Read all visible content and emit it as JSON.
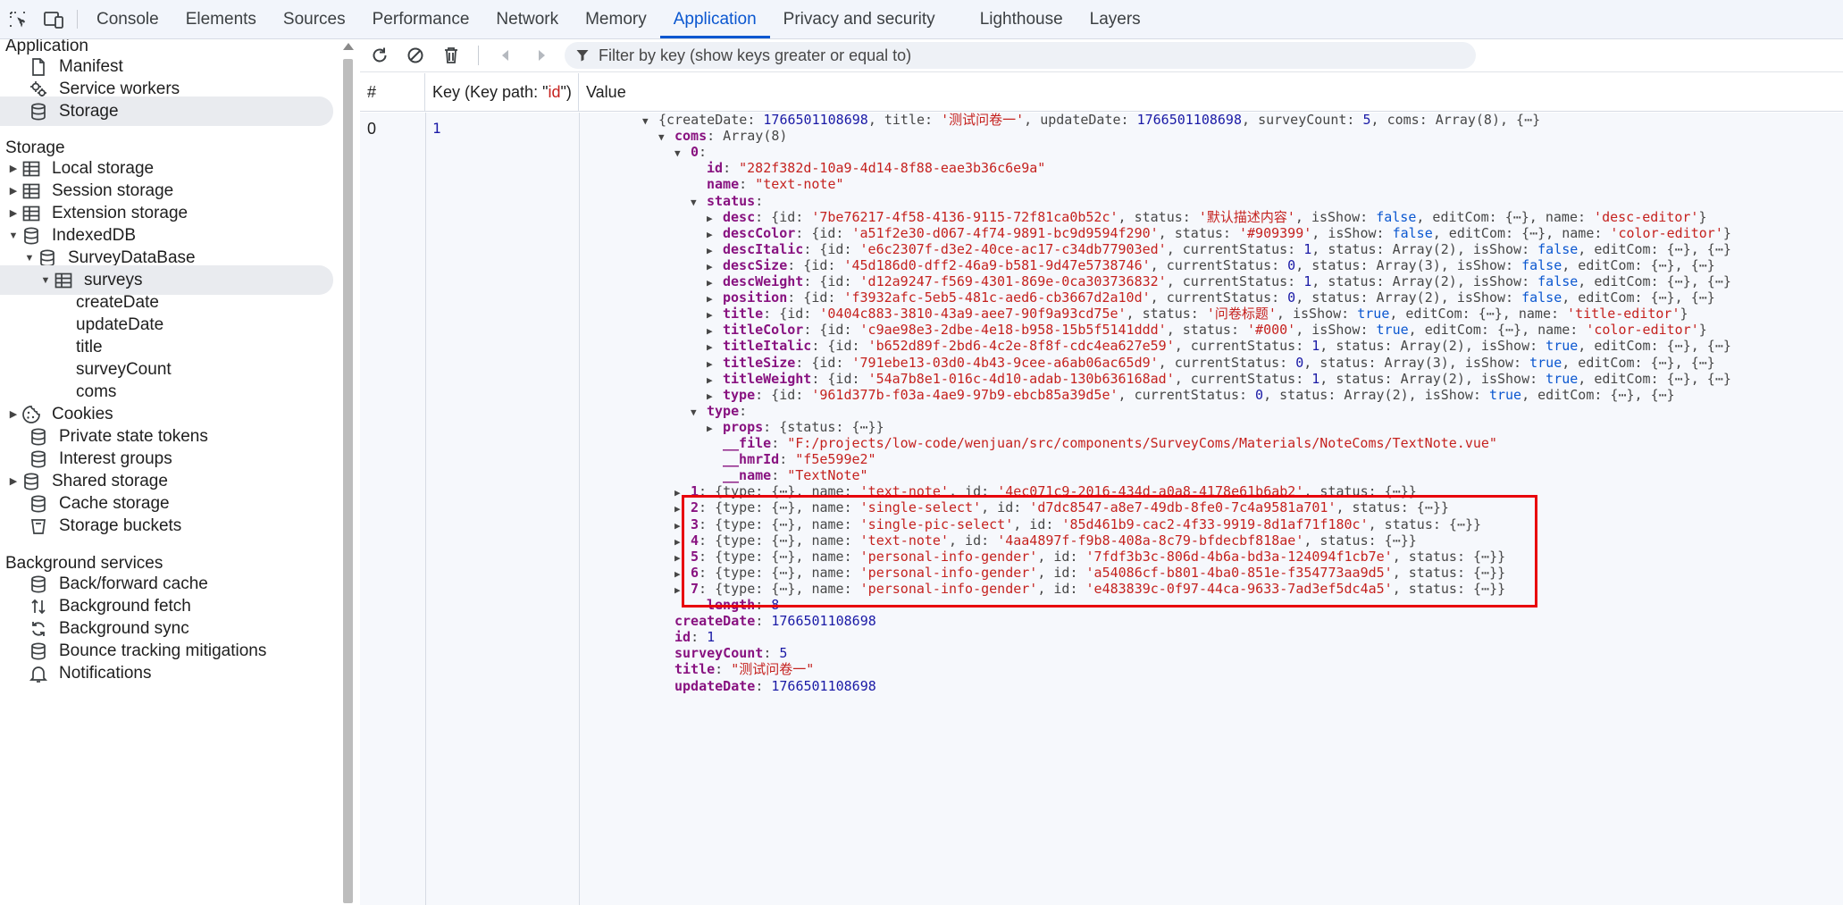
{
  "tabs": [
    "Console",
    "Elements",
    "Sources",
    "Performance",
    "Network",
    "Memory",
    "Application",
    "Privacy and security",
    "Lighthouse",
    "Layers"
  ],
  "active_tab": "Application",
  "sidebar": {
    "sections": [
      {
        "title": "Application"
      },
      {
        "title": "Storage"
      },
      {
        "title": "Background services"
      }
    ],
    "application_items": [
      "Manifest",
      "Service workers",
      "Storage"
    ],
    "storage_items": [
      "Local storage",
      "Session storage",
      "Extension storage",
      "IndexedDB",
      "SurveyDataBase",
      "surveys",
      "createDate",
      "updateDate",
      "title",
      "surveyCount",
      "coms",
      "Cookies",
      "Private state tokens",
      "Interest groups",
      "Shared storage",
      "Cache storage",
      "Storage buckets"
    ],
    "background_items": [
      "Back/forward cache",
      "Background fetch",
      "Background sync",
      "Bounce tracking mitigations",
      "Notifications"
    ]
  },
  "toolbar": {
    "filter_placeholder": "Filter by key (show keys greater or equal to)"
  },
  "table": {
    "col_index": "#",
    "col_key_prefix": "Key (Key path: \"",
    "col_key_path": "id",
    "col_key_suffix": "\")",
    "col_value": "Value",
    "row_index": "0",
    "row_key": "1"
  },
  "tree_lines": [
    [
      [
        null,
        "▼ "
      ],
      [
        "p",
        "{"
      ],
      [
        "kp",
        "createDate"
      ],
      [
        "p",
        ": "
      ],
      [
        "n",
        "1766501108698"
      ],
      [
        "p",
        ", "
      ],
      [
        "kp",
        "title"
      ],
      [
        "p",
        ": "
      ],
      [
        "s",
        "'测试问卷一'"
      ],
      [
        "p",
        ", "
      ],
      [
        "kp",
        "updateDate"
      ],
      [
        "p",
        ": "
      ],
      [
        "n",
        "1766501108698"
      ],
      [
        "p",
        ", "
      ],
      [
        "kp",
        "surveyCount"
      ],
      [
        "p",
        ": "
      ],
      [
        "n",
        "5"
      ],
      [
        "p",
        ", "
      ],
      [
        "kp",
        "coms"
      ],
      [
        "p",
        ": Array(8),  {⋯}"
      ]
    ],
    [
      [
        null,
        "▼ "
      ],
      [
        "k",
        "coms"
      ],
      [
        "p",
        ": Array(8)"
      ]
    ],
    [
      [
        null,
        "▼ "
      ],
      [
        "k",
        "0"
      ],
      [
        "p",
        ":"
      ]
    ],
    [
      [
        null,
        ""
      ],
      [
        "k",
        "id"
      ],
      [
        "p",
        ": "
      ],
      [
        "s",
        "\"282f382d-10a9-4d14-8f88-eae3b36c6e9a\""
      ]
    ],
    [
      [
        null,
        ""
      ],
      [
        "k",
        "name"
      ],
      [
        "p",
        ": "
      ],
      [
        "s",
        "\"text-note\""
      ]
    ],
    [
      [
        null,
        "▼ "
      ],
      [
        "k",
        "status"
      ],
      [
        "p",
        ":"
      ]
    ],
    [
      [
        null,
        "▶ "
      ],
      [
        "k",
        "desc"
      ],
      [
        "p",
        ": {id: "
      ],
      [
        "s",
        "'7be76217-4f58-4136-9115-72f81ca0b52c'"
      ],
      [
        "p",
        ", status: "
      ],
      [
        "s",
        "'默认描述内容'"
      ],
      [
        "p",
        ", isShow: "
      ],
      [
        "b",
        "false"
      ],
      [
        "p",
        ", editCom: {⋯}, name: "
      ],
      [
        "s",
        "'desc-editor'"
      ],
      [
        "p",
        "}"
      ]
    ],
    [
      [
        null,
        "▶ "
      ],
      [
        "k",
        "descColor"
      ],
      [
        "p",
        ": {id: "
      ],
      [
        "s",
        "'a51f2e30-d067-4f74-9891-bc9d9594f290'"
      ],
      [
        "p",
        ", status: "
      ],
      [
        "s",
        "'#909399'"
      ],
      [
        "p",
        ", isShow: "
      ],
      [
        "b",
        "false"
      ],
      [
        "p",
        ", editCom: {⋯}, name: "
      ],
      [
        "s",
        "'color-editor'"
      ],
      [
        "p",
        "}"
      ]
    ],
    [
      [
        null,
        "▶ "
      ],
      [
        "k",
        "descItalic"
      ],
      [
        "p",
        ": {id: "
      ],
      [
        "s",
        "'e6c2307f-d3e2-40ce-ac17-c34db77903ed'"
      ],
      [
        "p",
        ", currentStatus: "
      ],
      [
        "n",
        "1"
      ],
      [
        "p",
        ", status: Array(2), isShow: "
      ],
      [
        "b",
        "false"
      ],
      [
        "p",
        ", editCom: {⋯},  {⋯}"
      ]
    ],
    [
      [
        null,
        "▶ "
      ],
      [
        "k",
        "descSize"
      ],
      [
        "p",
        ": {id: "
      ],
      [
        "s",
        "'45d186d0-dff2-46a9-b581-9d47e5738746'"
      ],
      [
        "p",
        ", currentStatus: "
      ],
      [
        "n",
        "0"
      ],
      [
        "p",
        ", status: Array(3), isShow: "
      ],
      [
        "b",
        "false"
      ],
      [
        "p",
        ", editCom: {⋯},  {⋯}"
      ]
    ],
    [
      [
        null,
        "▶ "
      ],
      [
        "k",
        "descWeight"
      ],
      [
        "p",
        ": {id: "
      ],
      [
        "s",
        "'d12a9247-f569-4301-869e-0ca303736832'"
      ],
      [
        "p",
        ", currentStatus: "
      ],
      [
        "n",
        "1"
      ],
      [
        "p",
        ", status: Array(2), isShow: "
      ],
      [
        "b",
        "false"
      ],
      [
        "p",
        ", editCom: {⋯},  {⋯}"
      ]
    ],
    [
      [
        null,
        "▶ "
      ],
      [
        "k",
        "position"
      ],
      [
        "p",
        ": {id: "
      ],
      [
        "s",
        "'f3932afc-5eb5-481c-aed6-cb3667d2a10d'"
      ],
      [
        "p",
        ", currentStatus: "
      ],
      [
        "n",
        "0"
      ],
      [
        "p",
        ", status: Array(2), isShow: "
      ],
      [
        "b",
        "false"
      ],
      [
        "p",
        ", editCom: {⋯},  {⋯}"
      ]
    ],
    [
      [
        null,
        "▶ "
      ],
      [
        "k",
        "title"
      ],
      [
        "p",
        ": {id: "
      ],
      [
        "s",
        "'0404c883-3810-43a9-aee7-90f9a93cd75e'"
      ],
      [
        "p",
        ", status: "
      ],
      [
        "s",
        "'问卷标题'"
      ],
      [
        "p",
        ", isShow: "
      ],
      [
        "b",
        "true"
      ],
      [
        "p",
        ", editCom: {⋯}, name: "
      ],
      [
        "s",
        "'title-editor'"
      ],
      [
        "p",
        "}"
      ]
    ],
    [
      [
        null,
        "▶ "
      ],
      [
        "k",
        "titleColor"
      ],
      [
        "p",
        ": {id: "
      ],
      [
        "s",
        "'c9ae98e3-2dbe-4e18-b958-15b5f5141ddd'"
      ],
      [
        "p",
        ", status: "
      ],
      [
        "s",
        "'#000'"
      ],
      [
        "p",
        ", isShow: "
      ],
      [
        "b",
        "true"
      ],
      [
        "p",
        ", editCom: {⋯}, name: "
      ],
      [
        "s",
        "'color-editor'"
      ],
      [
        "p",
        "}"
      ]
    ],
    [
      [
        null,
        "▶ "
      ],
      [
        "k",
        "titleItalic"
      ],
      [
        "p",
        ": {id: "
      ],
      [
        "s",
        "'b652d89f-2bd6-4c2e-8f8f-cdc4ea627e59'"
      ],
      [
        "p",
        ", currentStatus: "
      ],
      [
        "n",
        "1"
      ],
      [
        "p",
        ", status: Array(2), isShow: "
      ],
      [
        "b",
        "true"
      ],
      [
        "p",
        ", editCom: {⋯},  {⋯}"
      ]
    ],
    [
      [
        null,
        "▶ "
      ],
      [
        "k",
        "titleSize"
      ],
      [
        "p",
        ": {id: "
      ],
      [
        "s",
        "'791ebe13-03d0-4b43-9cee-a6ab06ac65d9'"
      ],
      [
        "p",
        ", currentStatus: "
      ],
      [
        "n",
        "0"
      ],
      [
        "p",
        ", status: Array(3), isShow: "
      ],
      [
        "b",
        "true"
      ],
      [
        "p",
        ", editCom: {⋯},  {⋯}"
      ]
    ],
    [
      [
        null,
        "▶ "
      ],
      [
        "k",
        "titleWeight"
      ],
      [
        "p",
        ": {id: "
      ],
      [
        "s",
        "'54a7b8e1-016c-4d10-adab-130b636168ad'"
      ],
      [
        "p",
        ", currentStatus: "
      ],
      [
        "n",
        "1"
      ],
      [
        "p",
        ", status: Array(2), isShow: "
      ],
      [
        "b",
        "true"
      ],
      [
        "p",
        ", editCom: {⋯},  {⋯}"
      ]
    ],
    [
      [
        null,
        "▶ "
      ],
      [
        "k",
        "type"
      ],
      [
        "p",
        ": {id: "
      ],
      [
        "s",
        "'961d377b-f03a-4ae9-97b9-ebcb85a39d5e'"
      ],
      [
        "p",
        ", currentStatus: "
      ],
      [
        "n",
        "0"
      ],
      [
        "p",
        ", status: Array(2), isShow: "
      ],
      [
        "b",
        "true"
      ],
      [
        "p",
        ", editCom: {⋯},  {⋯}"
      ]
    ],
    [
      [
        null,
        "▼ "
      ],
      [
        "k",
        "type"
      ],
      [
        "p",
        ":"
      ]
    ],
    [
      [
        null,
        "▶ "
      ],
      [
        "k",
        "props"
      ],
      [
        "p",
        ": {status: {⋯}}"
      ]
    ],
    [
      [
        null,
        ""
      ],
      [
        "k",
        "__file"
      ],
      [
        "p",
        ": "
      ],
      [
        "s",
        "\"F:/projects/low-code/wenjuan/src/components/SurveyComs/Materials/NoteComs/TextNote.vue\""
      ]
    ],
    [
      [
        null,
        ""
      ],
      [
        "k",
        "__hmrId"
      ],
      [
        "p",
        ": "
      ],
      [
        "s",
        "\"f5e599e2\""
      ]
    ],
    [
      [
        null,
        ""
      ],
      [
        "k",
        "__name"
      ],
      [
        "p",
        ": "
      ],
      [
        "s",
        "\"TextNote\""
      ]
    ],
    [
      [
        null,
        "▶ "
      ],
      [
        "k",
        "1"
      ],
      [
        "p",
        ": {type: {⋯}, name: "
      ],
      [
        "s",
        "'text-note'"
      ],
      [
        "p",
        ", id: "
      ],
      [
        "s",
        "'4ec071c9-2016-434d-a0a8-4178e61b6ab2'"
      ],
      [
        "p",
        ", status: {⋯}}"
      ]
    ],
    [
      [
        null,
        "▶ "
      ],
      [
        "k",
        "2"
      ],
      [
        "p",
        ": {type: {⋯}, name: "
      ],
      [
        "s",
        "'single-select'"
      ],
      [
        "p",
        ", id: "
      ],
      [
        "s",
        "'d7dc8547-a8e7-49db-8fe0-7c4a9581a701'"
      ],
      [
        "p",
        ", status: {⋯}}"
      ]
    ],
    [
      [
        null,
        "▶ "
      ],
      [
        "k",
        "3"
      ],
      [
        "p",
        ": {type: {⋯}, name: "
      ],
      [
        "s",
        "'single-pic-select'"
      ],
      [
        "p",
        ", id: "
      ],
      [
        "s",
        "'85d461b9-cac2-4f33-9919-8d1af71f180c'"
      ],
      [
        "p",
        ", status: {⋯}}"
      ]
    ],
    [
      [
        null,
        "▶ "
      ],
      [
        "k",
        "4"
      ],
      [
        "p",
        ": {type: {⋯}, name: "
      ],
      [
        "s",
        "'text-note'"
      ],
      [
        "p",
        ", id: "
      ],
      [
        "s",
        "'4aa4897f-f9b8-408a-8c79-bfdecbf818ae'"
      ],
      [
        "p",
        ", status: {⋯}}"
      ]
    ],
    [
      [
        null,
        "▶ "
      ],
      [
        "k",
        "5"
      ],
      [
        "p",
        ": {type: {⋯}, name: "
      ],
      [
        "s",
        "'personal-info-gender'"
      ],
      [
        "p",
        ", id: "
      ],
      [
        "s",
        "'7fdf3b3c-806d-4b6a-bd3a-124094f1cb7e'"
      ],
      [
        "p",
        ", status: {⋯}}"
      ]
    ],
    [
      [
        null,
        "▶ "
      ],
      [
        "k",
        "6"
      ],
      [
        "p",
        ": {type: {⋯}, name: "
      ],
      [
        "s",
        "'personal-info-gender'"
      ],
      [
        "p",
        ", id: "
      ],
      [
        "s",
        "'a54086cf-b801-4ba0-851e-f354773aa9d5'"
      ],
      [
        "p",
        ", status: {⋯}}"
      ]
    ],
    [
      [
        null,
        "▶ "
      ],
      [
        "k",
        "7"
      ],
      [
        "p",
        ": {type: {⋯}, name: "
      ],
      [
        "s",
        "'personal-info-gender'"
      ],
      [
        "p",
        ", id: "
      ],
      [
        "s",
        "'e483839c-0f97-44ca-9633-7ad3ef5dc4a5'"
      ],
      [
        "p",
        ", status: {⋯}}"
      ]
    ],
    [
      [
        null,
        ""
      ],
      [
        "kg",
        "length"
      ],
      [
        "p",
        ": "
      ],
      [
        "n",
        "8"
      ]
    ],
    [
      [
        null,
        ""
      ],
      [
        "k",
        "createDate"
      ],
      [
        "p",
        ": "
      ],
      [
        "n",
        "1766501108698"
      ]
    ],
    [
      [
        null,
        ""
      ],
      [
        "k",
        "id"
      ],
      [
        "p",
        ": "
      ],
      [
        "n",
        "1"
      ]
    ],
    [
      [
        null,
        ""
      ],
      [
        "k",
        "surveyCount"
      ],
      [
        "p",
        ": "
      ],
      [
        "n",
        "5"
      ]
    ],
    [
      [
        null,
        ""
      ],
      [
        "k",
        "title"
      ],
      [
        "p",
        ": "
      ],
      [
        "s",
        "\"测试问卷一\""
      ]
    ],
    [
      [
        null,
        ""
      ],
      [
        "k",
        "updateDate"
      ],
      [
        "p",
        ": "
      ],
      [
        "n",
        "1766501108698"
      ]
    ]
  ]
}
